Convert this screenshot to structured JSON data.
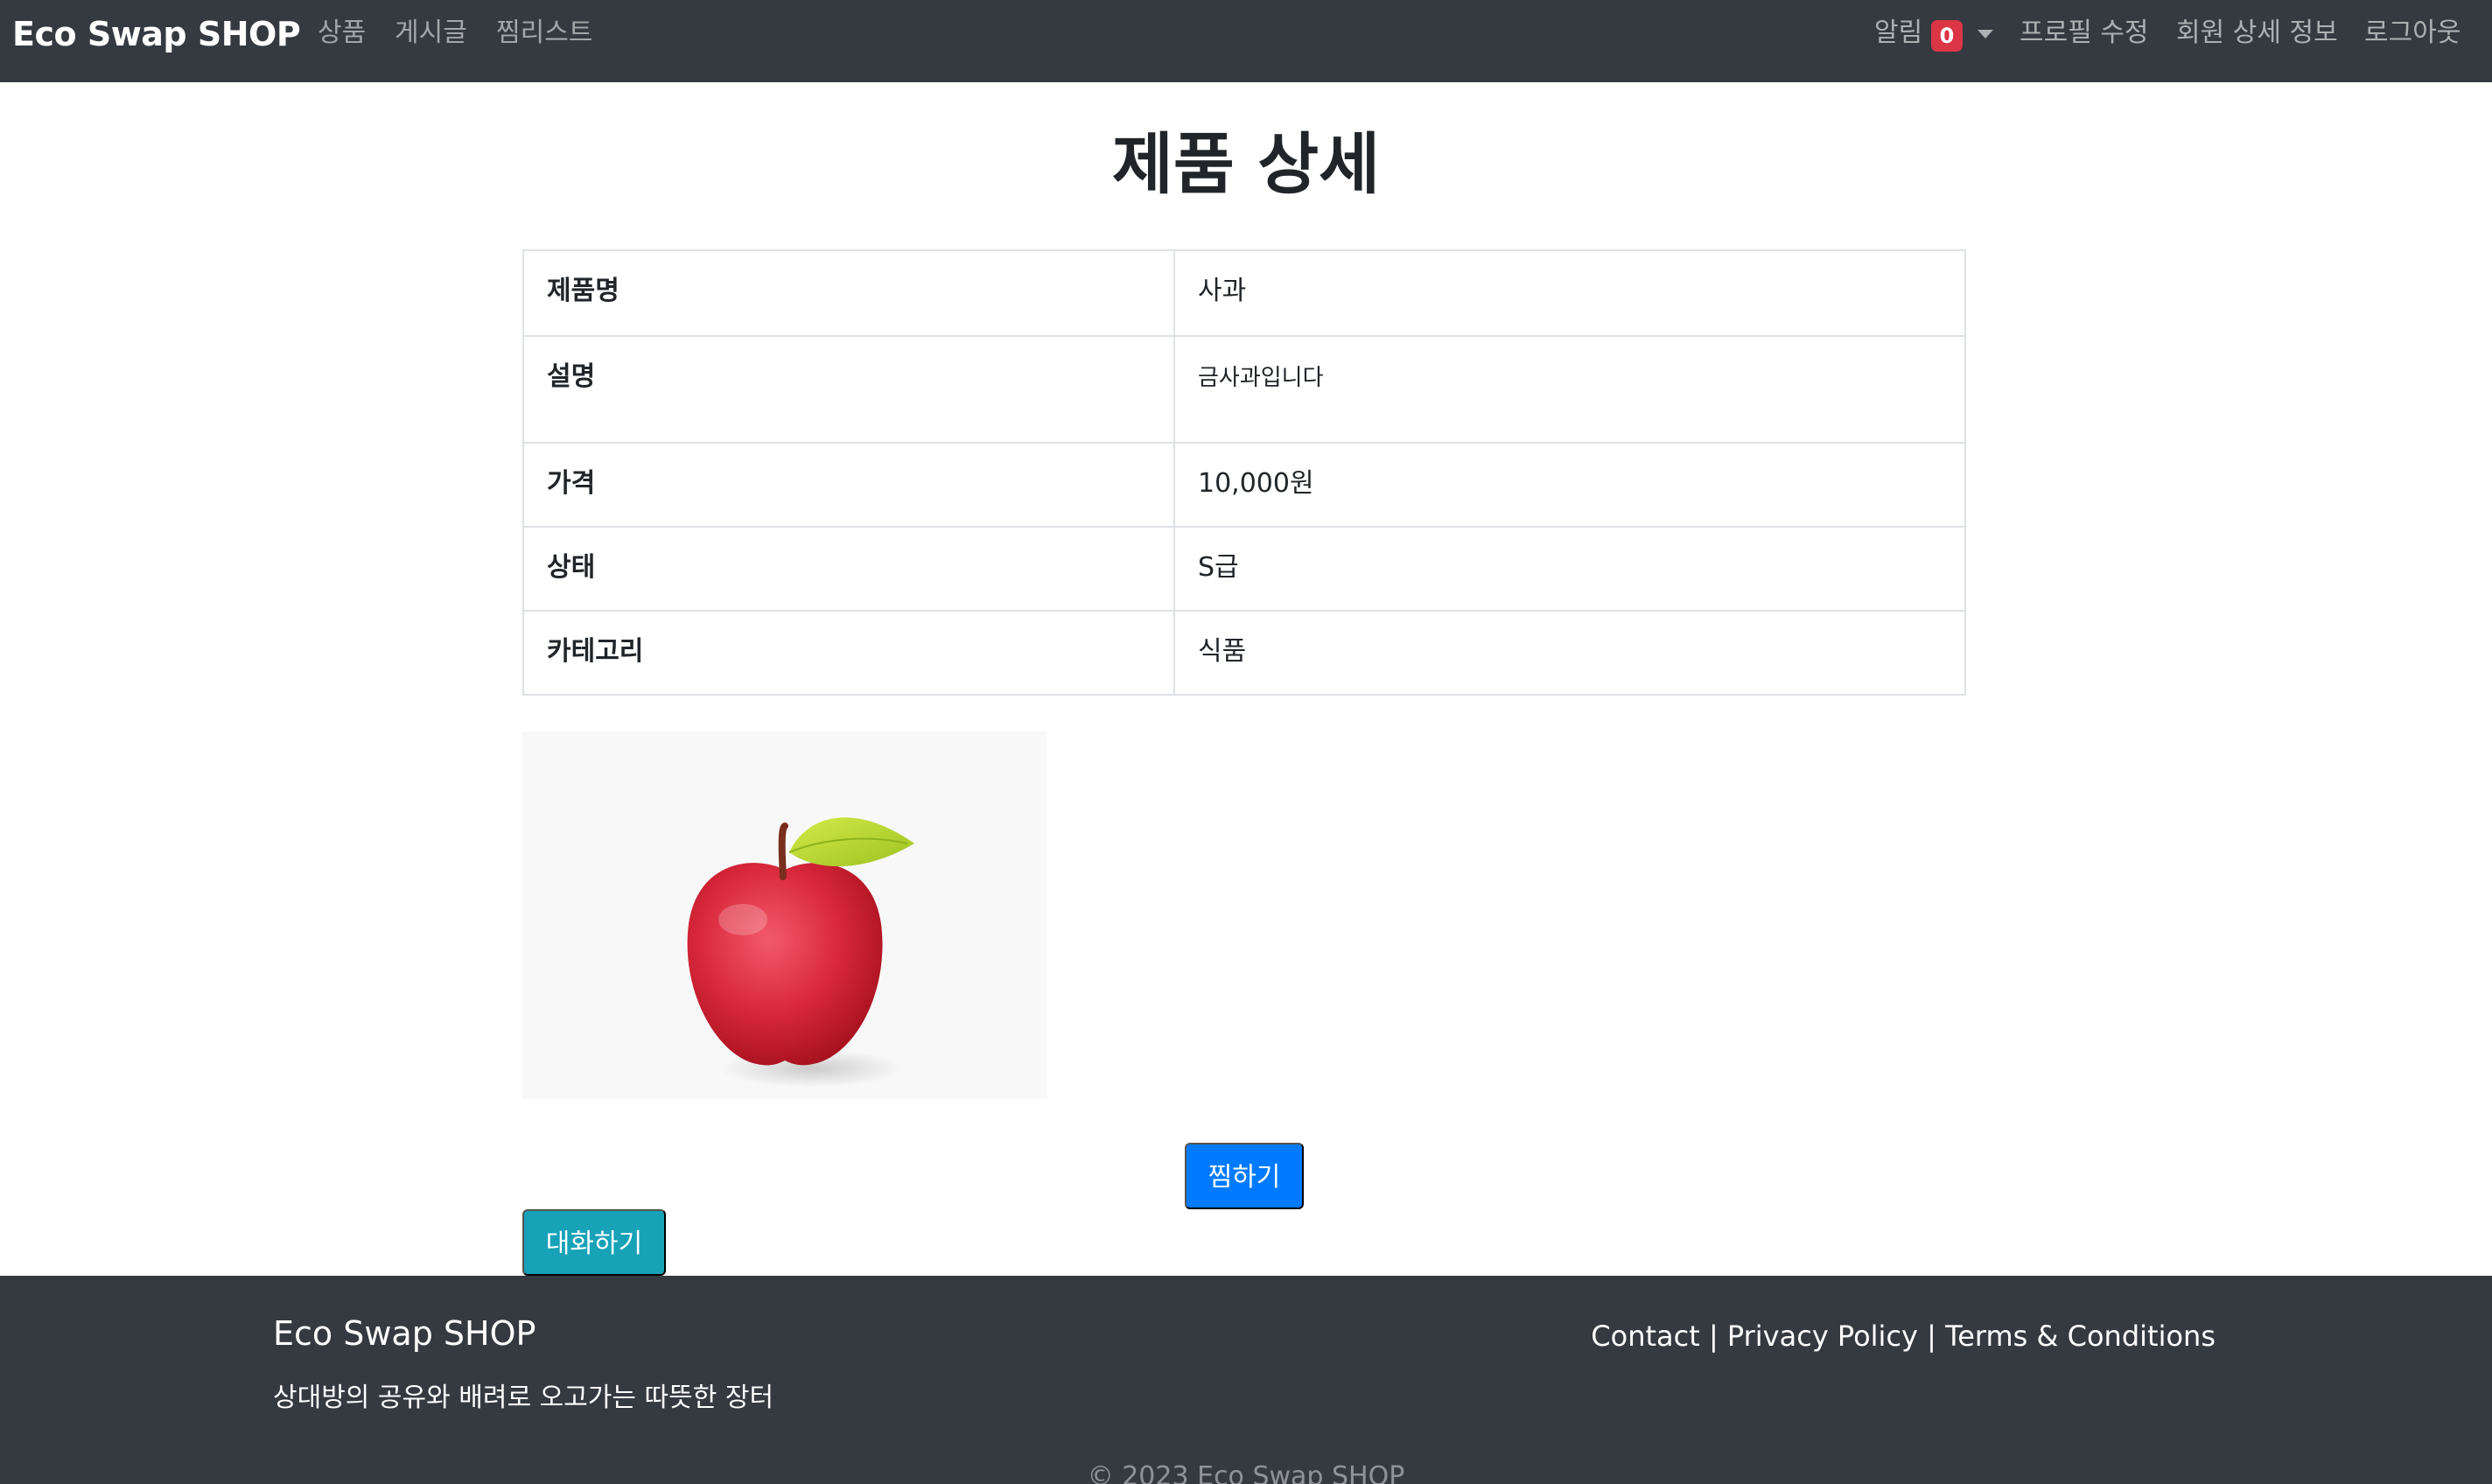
{
  "navbar": {
    "brand": "Eco Swap SHOP",
    "left_links": [
      "상품",
      "게시글",
      "찜리스트"
    ],
    "notification_label": "알림",
    "notification_count": "0",
    "right_links": [
      "프로필 수정",
      "회원 상세 정보",
      "로그아웃"
    ]
  },
  "page_title": "제품 상세",
  "details": {
    "name_label": "제품명",
    "name_value": "사과",
    "desc_label": "설명",
    "desc_value": "금사과입니다",
    "price_label": "가격",
    "price_value": "10,000원",
    "condition_label": "상태",
    "condition_value": "S급",
    "category_label": "카테고리",
    "category_value": "식품"
  },
  "buttons": {
    "wish": "찜하기",
    "chat": "대화하기"
  },
  "footer": {
    "brand": "Eco Swap SHOP",
    "tagline": "상대방의 공유와 배려로 오고가는 따뜻한 장터",
    "links": [
      "Contact",
      "Privacy Policy",
      "Terms & Conditions"
    ],
    "separator": " | ",
    "copyright": "© 2023 Eco Swap SHOP"
  },
  "colors": {
    "navbar_bg": "#343a40",
    "primary": "#007bff",
    "info": "#17a2b8",
    "danger": "#dc3545"
  },
  "icons": [
    "caret-down-icon",
    "apple-image"
  ]
}
